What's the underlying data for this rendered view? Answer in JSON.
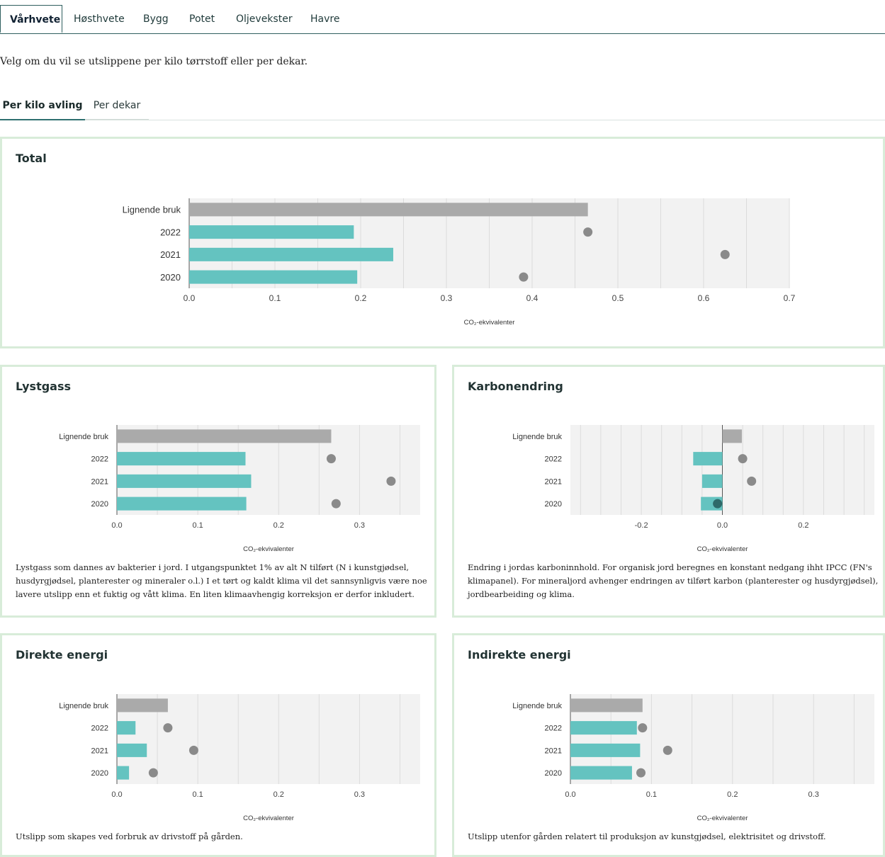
{
  "tabs": [
    {
      "label": "Vårhvete",
      "active": true
    },
    {
      "label": "Høsthvete",
      "active": false
    },
    {
      "label": "Bygg",
      "active": false
    },
    {
      "label": "Potet",
      "active": false
    },
    {
      "label": "Oljevekster",
      "active": false
    },
    {
      "label": "Havre",
      "active": false
    }
  ],
  "intro_text": "Velg om du vil se utslippene per kilo tørrstoff eller per dekar.",
  "subtabs": [
    {
      "label": "Per kilo avling",
      "active": true
    },
    {
      "label": "Per dekar",
      "active": false
    }
  ],
  "colors": {
    "bar_current": "#64c3c0",
    "bar_similar": "#aaaaaa",
    "dot": "#8a8a8a",
    "dot_dark": "#2e6a6a",
    "plot_bg": "#f2f2f2",
    "card_border": "#d8ecd9"
  },
  "chart_data": [
    {
      "id": "total",
      "type": "bar",
      "title": "Total",
      "categories": [
        "Lignende bruk",
        "2022",
        "2021",
        "2020"
      ],
      "series": [
        {
          "values": [
            0.465,
            0.192,
            0.238,
            0.196
          ]
        }
      ],
      "dots": [
        null,
        0.465,
        0.625,
        0.39
      ],
      "xlim": [
        0,
        0.7
      ],
      "xticks": [
        "0.0",
        "0.1",
        "0.2",
        "0.3",
        "0.4",
        "0.5",
        "0.6",
        "0.7"
      ],
      "xlabel": "CO₂-ekvivalenter",
      "description": ""
    },
    {
      "id": "lystgass",
      "type": "bar",
      "title": "Lystgass",
      "categories": [
        "Lignende bruk",
        "2022",
        "2021",
        "2020"
      ],
      "series": [
        {
          "values": [
            0.265,
            0.159,
            0.166,
            0.16
          ]
        }
      ],
      "dots": [
        null,
        0.265,
        0.339,
        0.271
      ],
      "xlim": [
        0,
        0.375
      ],
      "xticks": [
        "0.0",
        "0.1",
        "0.2",
        "0.3"
      ],
      "xlabel": "CO₂-ekvivalenter",
      "description": [
        "Lystgass som dannes av bakterier i jord. I utgangspunktet 1% av alt N tilført (N i kunstgjødsel,",
        "husdyrgjødsel, planterester og mineraler o.l.) I et tørt og kaldt klima vil det sannsynligvis være noe",
        "lavere utslipp enn et fuktig og vått klima. En liten klimaavhengig korreksjon er derfor inkludert."
      ]
    },
    {
      "id": "karbonendring",
      "type": "bar",
      "title": "Karbonendring",
      "categories": [
        "Lignende bruk",
        "2022",
        "2021",
        "2020"
      ],
      "series": [
        {
          "values": [
            0.048,
            -0.072,
            -0.05,
            -0.053
          ]
        }
      ],
      "dots": [
        null,
        0.05,
        0.072,
        -0.012
      ],
      "xlim": [
        -0.375,
        0.375
      ],
      "xticks": [
        "-0.2",
        "0.0",
        "0.2"
      ],
      "xlabel": "CO₂-ekvivalenter",
      "description": [
        "Endring i jordas karboninnhold. For organisk jord beregnes en konstant nedgang ihht IPCC (FN's",
        "klimapanel). For mineraljord avhenger endringen av tilført karbon (planterester og husdyrgjødsel),",
        "jordbearbeiding og klima."
      ]
    },
    {
      "id": "direkte",
      "type": "bar",
      "title": "Direkte energi",
      "categories": [
        "Lignende bruk",
        "2022",
        "2021",
        "2020"
      ],
      "series": [
        {
          "values": [
            0.063,
            0.023,
            0.037,
            0.015
          ]
        }
      ],
      "dots": [
        null,
        0.063,
        0.095,
        0.045
      ],
      "xlim": [
        0,
        0.375
      ],
      "xticks": [
        "0.0",
        "0.1",
        "0.2",
        "0.3"
      ],
      "xlabel": "CO₂-ekvivalenter",
      "description": [
        "Utslipp som skapes ved forbruk av drivstoff på gården."
      ]
    },
    {
      "id": "indirekte",
      "type": "bar",
      "title": "Indirekte energi",
      "categories": [
        "Lignende bruk",
        "2022",
        "2021",
        "2020"
      ],
      "series": [
        {
          "values": [
            0.089,
            0.082,
            0.086,
            0.076
          ]
        }
      ],
      "dots": [
        null,
        0.089,
        0.12,
        0.087
      ],
      "xlim": [
        0,
        0.375
      ],
      "xticks": [
        "0.0",
        "0.1",
        "0.2",
        "0.3"
      ],
      "xlabel": "CO₂-ekvivalenter",
      "description": [
        "Utslipp utenfor gården relatert til produksjon av kunstgjødsel, elektrisitet og drivstoff."
      ]
    }
  ]
}
